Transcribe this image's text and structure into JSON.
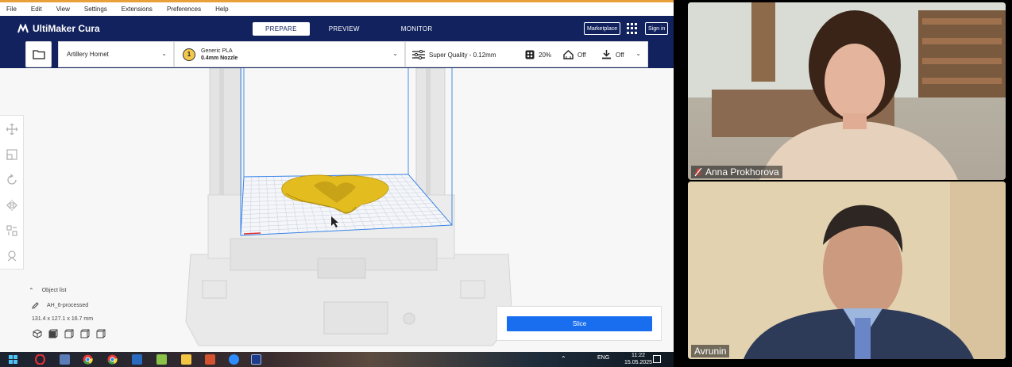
{
  "cura": {
    "menu": [
      "File",
      "Edit",
      "View",
      "Settings",
      "Extensions",
      "Preferences",
      "Help"
    ],
    "logo": "UltiMaker Cura",
    "stages": [
      {
        "label": "PREPARE",
        "active": true
      },
      {
        "label": "PREVIEW",
        "active": false
      },
      {
        "label": "MONITOR",
        "active": false
      }
    ],
    "marketplace_label": "Marketplace",
    "signin_label": "Sign in",
    "printer": "Artillery Hornet",
    "extruder_number": "1",
    "material": "Generic PLA",
    "nozzle": "0.4mm Nozzle",
    "profile": "Super Quality - 0.12mm",
    "infill": "20%",
    "support": "Off",
    "adhesion": "Off",
    "object_list_label": "Object list",
    "object_name": "AH_6-processed",
    "object_dims": "131.4 x 127.1 x 16.7 mm",
    "slice_label": "Slice",
    "colors": {
      "header": "#12225e",
      "accent": "#196ef0",
      "model": "#e5c022",
      "build_volume": "#2f80ed"
    }
  },
  "taskbar": {
    "lang": "ENG",
    "time": "11:22",
    "date": "15.05.2025",
    "icons": [
      "windows-start-icon",
      "opera-icon",
      "files-icon",
      "chrome-icon",
      "chrome-icon",
      "notepad-icon",
      "photos-icon",
      "folder-icon",
      "powerpoint-icon",
      "zoom-icon",
      "cura-icon"
    ]
  },
  "participants": [
    {
      "name": "Anna Prokhorova",
      "muted": true
    },
    {
      "name": "Avrunin",
      "muted": false
    }
  ]
}
